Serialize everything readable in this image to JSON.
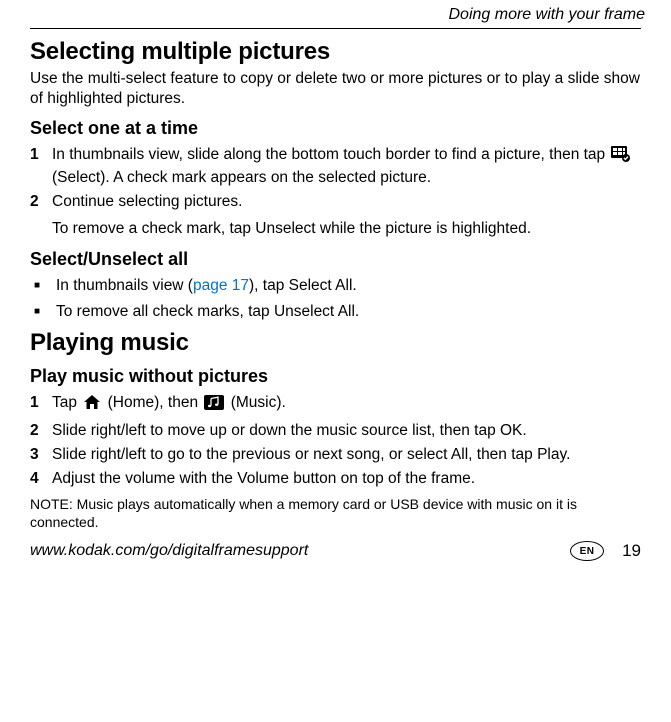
{
  "running_head": "Doing more with your frame",
  "section1": {
    "title": "Selecting multiple pictures",
    "intro": "Use the multi-select feature to copy or delete two or more pictures or to play a slide show of highlighted pictures.",
    "sub1": {
      "title": "Select one at a time",
      "step1_a": "In thumbnails view, slide along the bottom touch border to find a picture, then tap ",
      "step1_b": " (Select). A check mark appears on the selected picture.",
      "step2": "Continue selecting pictures.",
      "note_after": "To remove a check mark, tap Unselect while the picture is highlighted."
    },
    "sub2": {
      "title": "Select/Unselect all",
      "b1_a": "In thumbnails view (",
      "b1_link": "page 17",
      "b1_b": "), tap Select All.",
      "b2": "To remove all check marks, tap Unselect All."
    }
  },
  "section2": {
    "title": "Playing music",
    "sub1": {
      "title": "Play music without pictures",
      "s1_a": "Tap ",
      "s1_b": " (Home), then ",
      "s1_c": " (Music).",
      "s2": "Slide right/left to move up or down the music source list, then tap OK.",
      "s3": "Slide right/left to go to the previous or next song, or select All, then tap Play.",
      "s4": "Adjust the volume with the Volume button on top of the frame."
    },
    "note": "NOTE:  Music plays automatically when a memory card or USB device with music on it is connected."
  },
  "footer": {
    "url": "www.kodak.com/go/digitalframesupport",
    "lang": "EN",
    "page": "19"
  }
}
